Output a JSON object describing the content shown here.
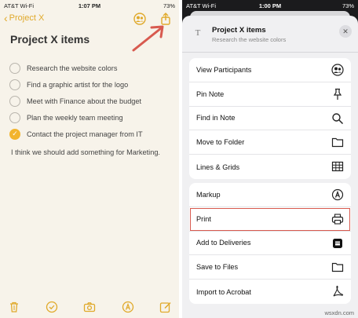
{
  "left": {
    "status": {
      "carrier": "AT&T Wi-Fi",
      "time": "1:07 PM",
      "battery": "73%"
    },
    "nav": {
      "back_label": "Project X"
    },
    "note_title": "Project X items",
    "checklist": [
      {
        "text": "Research the website colors",
        "done": false
      },
      {
        "text": "Find a graphic artist for the logo",
        "done": false
      },
      {
        "text": "Meet with Finance about the budget",
        "done": false
      },
      {
        "text": "Plan the weekly team meeting",
        "done": false
      },
      {
        "text": "Contact the project manager from IT",
        "done": true
      }
    ],
    "body_text": "I think we should add something for Marketing.",
    "accent": "#e0a92a",
    "arrow_color": "#d85a4f"
  },
  "right": {
    "status": {
      "carrier": "AT&T Wi-Fi",
      "time": "1:00 PM",
      "battery": "73%"
    },
    "sheet": {
      "title": "Project X items",
      "subtitle": "Research the website colors",
      "doc_icon_glyph": "T",
      "close_glyph": "✕"
    },
    "group1": [
      {
        "label": "View Participants",
        "icon": "participants-icon"
      },
      {
        "label": "Pin Note",
        "icon": "pin-icon"
      },
      {
        "label": "Find in Note",
        "icon": "search-icon"
      },
      {
        "label": "Move to Folder",
        "icon": "folder-icon"
      },
      {
        "label": "Lines & Grids",
        "icon": "grid-icon"
      }
    ],
    "group2": [
      {
        "label": "Markup",
        "icon": "markup-icon"
      },
      {
        "label": "Print",
        "icon": "printer-icon",
        "highlighted": true
      },
      {
        "label": "Add to Deliveries",
        "icon": "deliveries-icon"
      },
      {
        "label": "Save to Files",
        "icon": "folder-icon"
      },
      {
        "label": "Import to Acrobat",
        "icon": "acrobat-icon"
      }
    ],
    "highlight_color": "#d85a4f",
    "watermark": "wsxdn.com"
  }
}
